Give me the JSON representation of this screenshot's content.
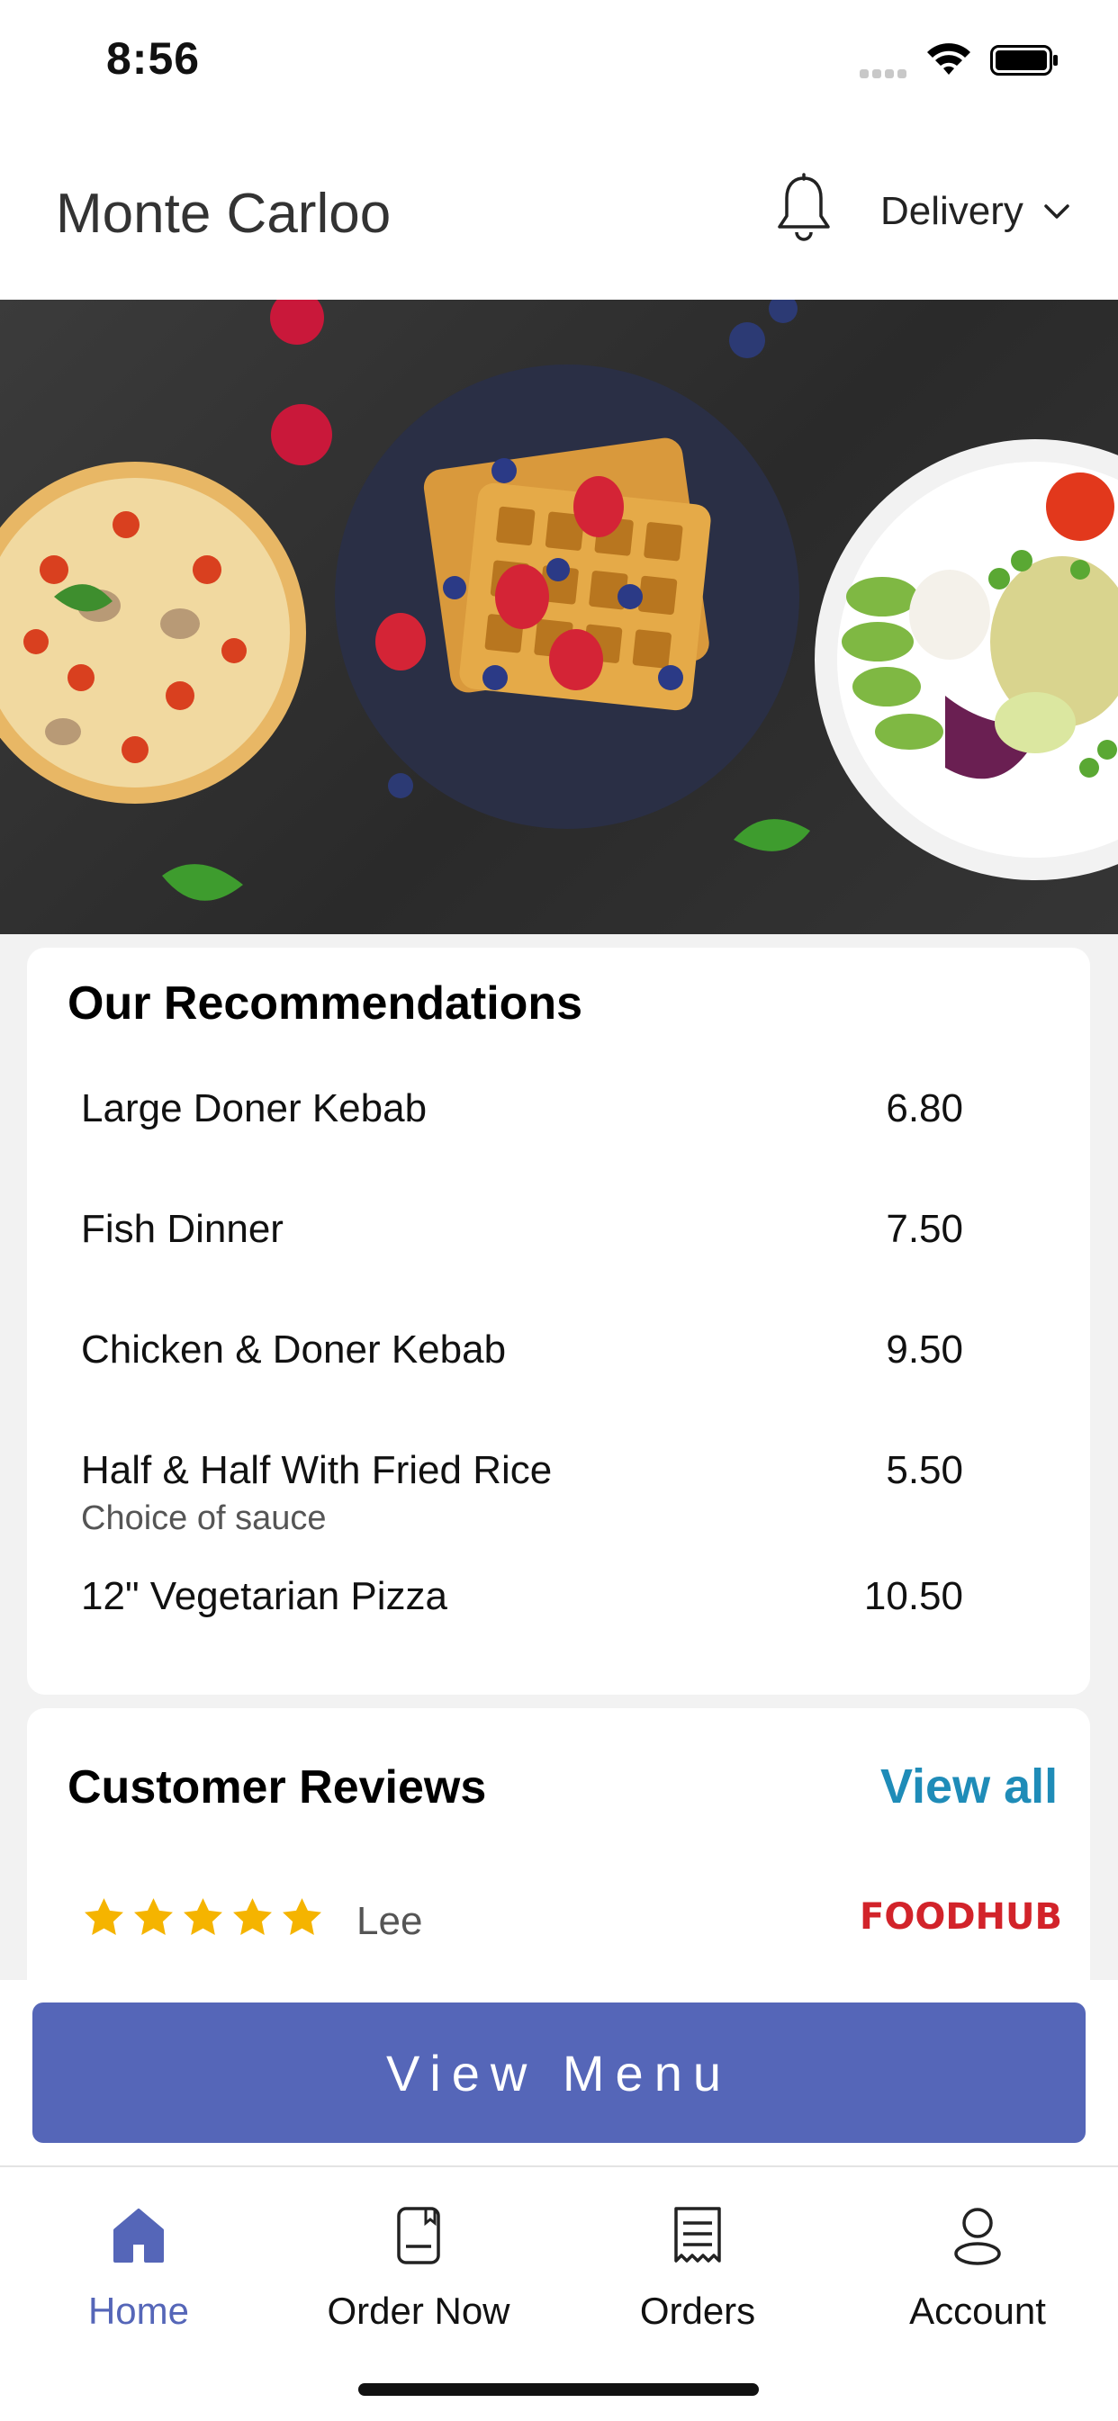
{
  "status_bar": {
    "time": "8:56"
  },
  "header": {
    "title": "Monte Carloo",
    "delivery_label": "Delivery"
  },
  "recommendations": {
    "title": "Our Recommendations",
    "items": [
      {
        "name": "Large Doner Kebab",
        "price": "6.80",
        "subtitle": ""
      },
      {
        "name": "Fish Dinner",
        "price": "7.50",
        "subtitle": ""
      },
      {
        "name": "Chicken & Doner Kebab",
        "price": "9.50",
        "subtitle": ""
      },
      {
        "name": "Half & Half With Fried Rice",
        "price": "5.50",
        "subtitle": "Choice of sauce"
      },
      {
        "name": "12\" Vegetarian  Pizza",
        "price": "10.50",
        "subtitle": ""
      }
    ]
  },
  "reviews": {
    "title": "Customer Reviews",
    "view_all": "View all",
    "items": [
      {
        "rating": 5,
        "name": "Lee",
        "source": "FOODHUB"
      }
    ]
  },
  "cta": {
    "label": "View Menu"
  },
  "tabs": [
    {
      "label": "Home",
      "icon": "home-icon",
      "active": true
    },
    {
      "label": "Order Now",
      "icon": "order-now-icon",
      "active": false
    },
    {
      "label": "Orders",
      "icon": "receipt-icon",
      "active": false
    },
    {
      "label": "Account",
      "icon": "user-icon",
      "active": false
    }
  ],
  "colors": {
    "accent": "#5566b8",
    "link": "#1f8cb8",
    "star": "#f5b400",
    "foodhub": "#d2232a"
  }
}
